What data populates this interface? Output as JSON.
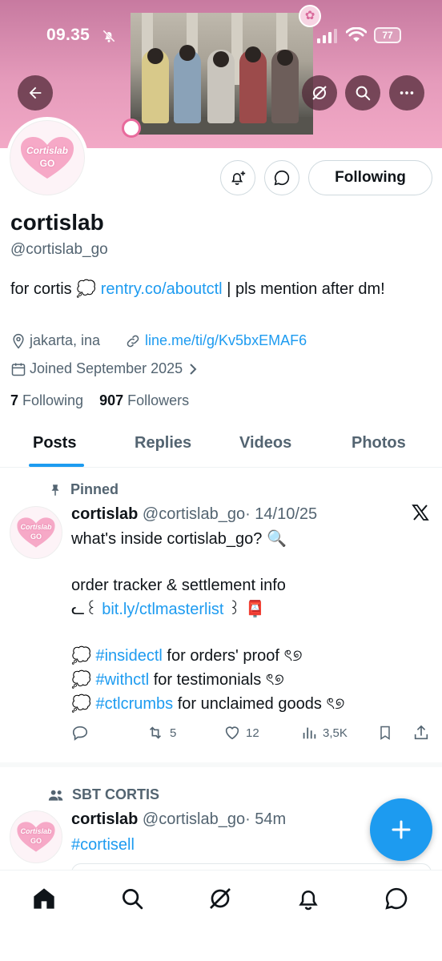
{
  "status_bar": {
    "time": "09.35",
    "battery": "77"
  },
  "profile": {
    "name": "cortislab",
    "handle": "@cortislab_go",
    "bio_prefix": "for cortis 💭 ",
    "bio_link": "rentry.co/aboutctl",
    "bio_suffix": " | pls mention after dm!",
    "location": "jakarta, ina",
    "website": "line.me/ti/g/Kv5bxEMAF6",
    "joined": "Joined September 2025",
    "following_count": "7",
    "following_label": "Following",
    "followers_count": "907",
    "followers_label": "Followers",
    "follow_button": "Following",
    "avatar_text_top": "Cortislab",
    "avatar_text_bottom": "GO"
  },
  "tabs": [
    {
      "label": "Posts",
      "active": true
    },
    {
      "label": "Replies"
    },
    {
      "label": "Videos"
    },
    {
      "label": "Photos"
    }
  ],
  "posts": [
    {
      "context": "Pinned",
      "name": "cortislab",
      "handle": "@cortislab_go",
      "time": "· 14/10/25",
      "line1": "what's inside cortislab_go? 🔍",
      "line2": "order tracker & settlement info",
      "line3_prefix": "ᓚ꒰ ",
      "line3_link": "bit.ly/ctlmasterlist",
      "line3_suffix": " ꒱ 📮",
      "tag1": "#insidectl",
      "tag1_text": " for orders' proof ৎ୭",
      "tag2": "#withctl",
      "tag2_text": " for testimonials  ৎ୭",
      "tag3": "#ctlcrumbs",
      "tag3_text": " for unclaimed goods ৎ୭",
      "bubble": "💭 ",
      "retweets": "5",
      "likes": "12",
      "views": "3,5K"
    },
    {
      "context": "SBT CORTIS",
      "name": "cortislab",
      "handle": "@cortislab_go",
      "time": "· 54m",
      "text": "#cortisell"
    }
  ],
  "colors": {
    "accent": "#1d9bf0",
    "banner_pink": "#e59bbb",
    "text_grey": "#536471"
  }
}
